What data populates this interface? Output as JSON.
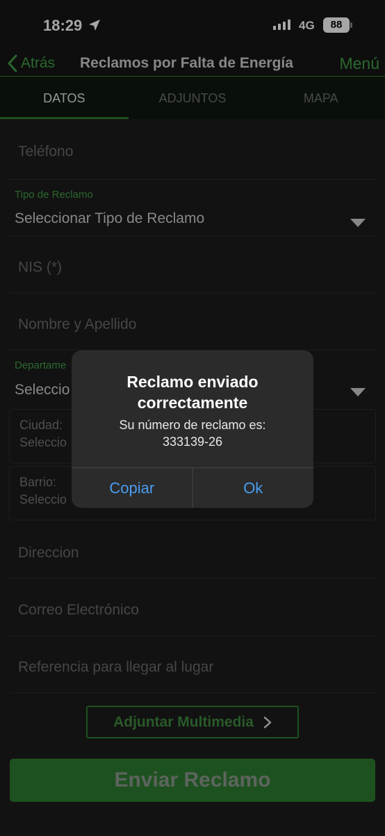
{
  "status_bar": {
    "time": "18:29",
    "network": "4G",
    "battery": "88"
  },
  "nav": {
    "back_label": "Atrás",
    "title": "Reclamos por Falta de Energía",
    "menu_label": "Menú"
  },
  "tabs": [
    {
      "label": "DATOS",
      "active": true
    },
    {
      "label": "ADJUNTOS",
      "active": false
    },
    {
      "label": "MAPA",
      "active": false
    }
  ],
  "form": {
    "telefono_placeholder": "Teléfono",
    "tipo_label": "Tipo de Reclamo",
    "tipo_value": "Seleccionar Tipo de Reclamo",
    "nis_placeholder": "NIS (*)",
    "nombre_placeholder": "Nombre y Apellido",
    "departamento_label": "Departame",
    "departamento_value": "Seleccio",
    "ciudad_label": "Ciudad:",
    "ciudad_value": "Seleccio",
    "barrio_label": "Barrio:",
    "barrio_value": "Seleccio",
    "direccion_placeholder": "Direccion",
    "correo_placeholder": "Correo Electrónico",
    "referencia_placeholder": "Referencia para llegar al lugar",
    "attach_label": "Adjuntar Multimedia",
    "send_label": "Enviar Reclamo"
  },
  "alert": {
    "title_line1": "Reclamo enviado",
    "title_line2": "correctamente",
    "message_line1": "Su número de reclamo es:",
    "message_line2": "333139-26",
    "copy_label": "Copiar",
    "ok_label": "Ok"
  },
  "colors": {
    "accent": "#2e7d32",
    "link_blue": "#4a9df0",
    "background": "#1c1c1c"
  }
}
